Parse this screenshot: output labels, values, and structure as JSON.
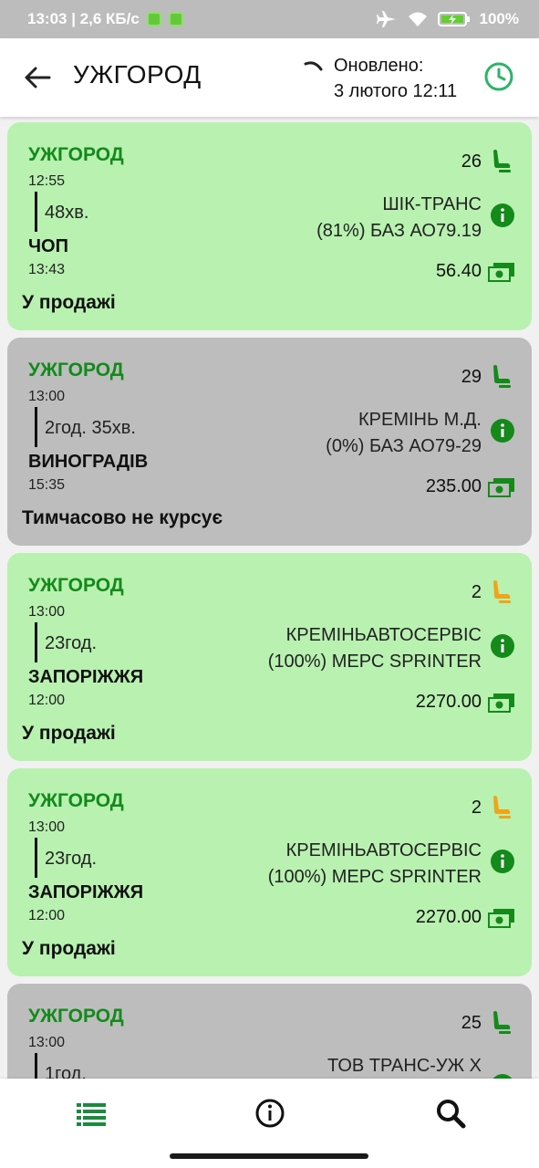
{
  "status_bar": {
    "time_net": "13:03 | 2,6 КБ/с",
    "battery": "100%"
  },
  "header": {
    "title": "УЖГОРОД",
    "updated_label": "Оновлено:",
    "updated_time": "3 лютого 12:11"
  },
  "colors": {
    "accent": "#1a8a3c",
    "available_card": "#b8f1b0",
    "unavailable_card": "#bdbdbd",
    "seat_many": "#138a1a",
    "seat_few": "#f0a417"
  },
  "trips": [
    {
      "from": "УЖГОРОД",
      "dep_time": "12:55",
      "duration": "48хв.",
      "to": "ЧОП",
      "arr_time": "13:43",
      "seats": "26",
      "seat_level": "many",
      "carrier_line1": "ШІК-ТРАНС",
      "carrier_line2": "(81%) БАЗ АО79.19",
      "price": "56.40",
      "status": "У продажі",
      "state": "available"
    },
    {
      "from": "УЖГОРОД",
      "dep_time": "13:00",
      "duration": "2год. 35хв.",
      "to": "ВИНОГРАДІВ",
      "arr_time": "15:35",
      "seats": "29",
      "seat_level": "many",
      "carrier_line1": "КРЕМІНЬ М.Д.",
      "carrier_line2": "(0%) БАЗ АО79-29",
      "price": "235.00",
      "status": "Тимчасово не курсує",
      "state": "unavailable"
    },
    {
      "from": "УЖГОРОД",
      "dep_time": "13:00",
      "duration": "23год.",
      "to": "ЗАПОРІЖЖЯ",
      "arr_time": "12:00",
      "seats": "2",
      "seat_level": "few",
      "carrier_line1": "КРЕМІНЬАВТОСЕРВІС",
      "carrier_line2": "(100%) МЕРС SPRINTER",
      "price": "2270.00",
      "status": "У продажі",
      "state": "available"
    },
    {
      "from": "УЖГОРОД",
      "dep_time": "13:00",
      "duration": "23год.",
      "to": "ЗАПОРІЖЖЯ",
      "arr_time": "12:00",
      "seats": "2",
      "seat_level": "few",
      "carrier_line1": "КРЕМІНЬАВТОСЕРВІС",
      "carrier_line2": "(100%) МЕРС SPRINTER",
      "price": "2270.00",
      "status": "У продажі",
      "state": "available"
    },
    {
      "from": "УЖГОРОД",
      "dep_time": "13:00",
      "duration": "1год.",
      "to": "",
      "arr_time": "",
      "seats": "25",
      "seat_level": "many",
      "carrier_line1": "ТОВ ТРАНС-УЖ Х",
      "carrier_line2": "",
      "price": "",
      "status": "",
      "state": "unavailable"
    }
  ],
  "bottom_nav": [
    {
      "name": "list-icon",
      "active": true
    },
    {
      "name": "info-icon",
      "active": false
    },
    {
      "name": "search-icon",
      "active": false
    }
  ]
}
